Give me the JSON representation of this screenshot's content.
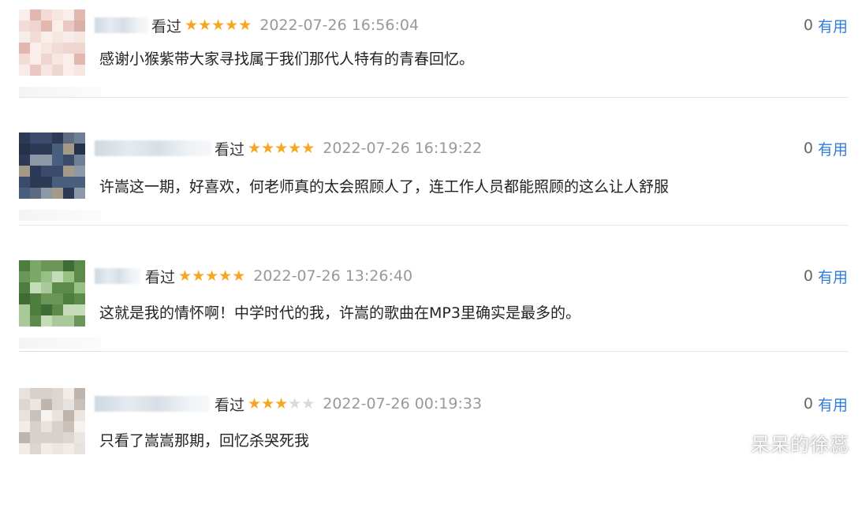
{
  "comments": [
    {
      "watched": "看过",
      "rating": 5,
      "time": "2022-07-26 16:56:04",
      "useful_count": "0",
      "useful_label": "有用",
      "content": "感谢小猴紫带大家寻找属于我们那代人特有的青春回忆。"
    },
    {
      "watched": "看过",
      "rating": 5,
      "time": "2022-07-26 16:19:22",
      "useful_count": "0",
      "useful_label": "有用",
      "content": "许嵩这一期，好喜欢，何老师真的太会照顾人了，连工作人员都能照顾的这么让人舒服"
    },
    {
      "watched": "看过",
      "rating": 5,
      "time": "2022-07-26 13:26:40",
      "useful_count": "0",
      "useful_label": "有用",
      "content": "这就是我的情怀啊！中学时代的我，许嵩的歌曲在MP3里确实是最多的。"
    },
    {
      "watched": "看过",
      "rating": 3,
      "time": "2022-07-26 00:19:33",
      "useful_count": "0",
      "useful_label": "有用",
      "content": "只看了嵩嵩那期，回忆杀哭死我"
    }
  ],
  "watermark": "呆呆的徐蕊",
  "colors": {
    "star_on": "#f6a623",
    "star_off": "#d9d9d9",
    "link": "#2f7ed8",
    "time": "#999999"
  }
}
